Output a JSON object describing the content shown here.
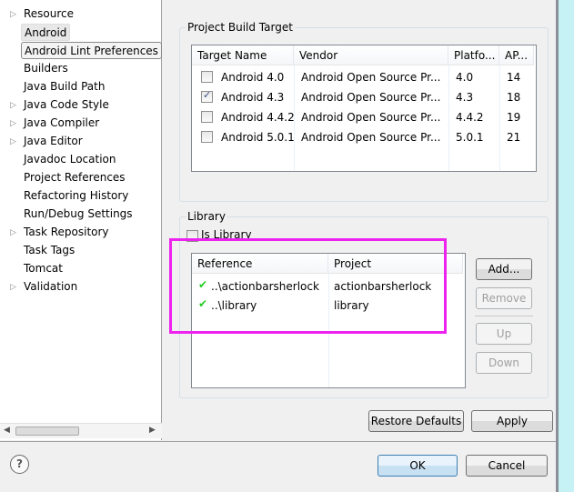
{
  "sidebar": {
    "items": [
      {
        "label": "Resource",
        "expandable": true
      },
      {
        "label": "Android",
        "expandable": false
      },
      {
        "label": "Android Lint Preferences",
        "expandable": false
      },
      {
        "label": "Builders",
        "expandable": false
      },
      {
        "label": "Java Build Path",
        "expandable": false
      },
      {
        "label": "Java Code Style",
        "expandable": true
      },
      {
        "label": "Java Compiler",
        "expandable": true
      },
      {
        "label": "Java Editor",
        "expandable": true
      },
      {
        "label": "Javadoc Location",
        "expandable": false
      },
      {
        "label": "Project References",
        "expandable": false
      },
      {
        "label": "Refactoring History",
        "expandable": false
      },
      {
        "label": "Run/Debug Settings",
        "expandable": false
      },
      {
        "label": "Task Repository",
        "expandable": true
      },
      {
        "label": "Task Tags",
        "expandable": false
      },
      {
        "label": "Tomcat",
        "expandable": false
      },
      {
        "label": "Validation",
        "expandable": true
      }
    ]
  },
  "build_target": {
    "title": "Project Build Target",
    "columns": [
      "Target Name",
      "Vendor",
      "Platfo...",
      "AP..."
    ],
    "rows": [
      {
        "name": "Android 4.0",
        "vendor": "Android Open Source Pr...",
        "platform": "4.0",
        "api": "14",
        "checked": false
      },
      {
        "name": "Android 4.3",
        "vendor": "Android Open Source Pr...",
        "platform": "4.3",
        "api": "18",
        "checked": true
      },
      {
        "name": "Android 4.4.2",
        "vendor": "Android Open Source Pr...",
        "platform": "4.4.2",
        "api": "19",
        "checked": false
      },
      {
        "name": "Android 5.0.1",
        "vendor": "Android Open Source Pr...",
        "platform": "5.0.1",
        "api": "21",
        "checked": false
      }
    ]
  },
  "library": {
    "title": "Library",
    "is_library_label": "Is Library",
    "is_library_checked": false,
    "columns": [
      "Reference",
      "Project"
    ],
    "rows": [
      {
        "reference": "..\\actionbarsherlock",
        "project": "actionbarsherlock"
      },
      {
        "reference": "..\\library",
        "project": "library"
      }
    ],
    "buttons": {
      "add": "Add...",
      "remove": "Remove",
      "up": "Up",
      "down": "Down"
    }
  },
  "footer": {
    "restore_defaults": "Restore Defaults",
    "apply": "Apply",
    "ok": "OK",
    "cancel": "Cancel"
  },
  "colors": {
    "highlight_box": "#ee22ee",
    "check_ok": "#22cc22"
  }
}
